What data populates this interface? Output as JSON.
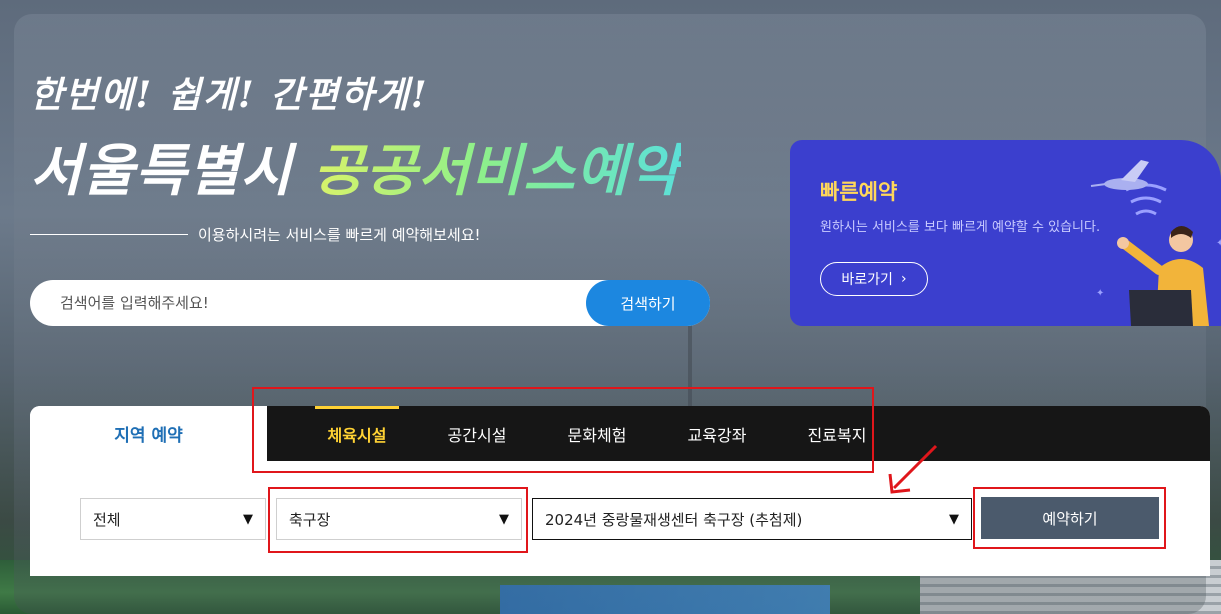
{
  "hero": {
    "line1": "한번에! 쉽게! 간편하게!",
    "line2_prefix": "서울특별시",
    "line2_highlight": "공공서비스예약",
    "subtitle": "이용하시려는 서비스를 빠르게 예약해보세요!"
  },
  "search": {
    "placeholder": "검색어를 입력해주세요!",
    "button_label": "검색하기"
  },
  "quick_reserve": {
    "title": "빠른예약",
    "description": "원하시는 서비스를 보다 빠르게 예약할 수 있습니다.",
    "button_label": "바로가기",
    "chevron": "›",
    "title_color": "#ffd75a",
    "background": "#3b3fce"
  },
  "panel": {
    "region_tab": "지역 예약",
    "tabs": [
      {
        "label": "체육시설",
        "active": true
      },
      {
        "label": "공간시설",
        "active": false
      },
      {
        "label": "문화체험",
        "active": false
      },
      {
        "label": "교육강좌",
        "active": false
      },
      {
        "label": "진료복지",
        "active": false
      }
    ],
    "filters": {
      "region": "전체",
      "facility_type": "축구장",
      "facility": "2024년 중랑물재생센터 축구장 (추첨제)",
      "arrow": "▼"
    },
    "reserve_button": "예약하기"
  },
  "colors": {
    "active_tab": "#ffd234",
    "search_button": "#1c87e0",
    "reserve_button": "#4b5a6c",
    "annotation": "#e0161b"
  }
}
